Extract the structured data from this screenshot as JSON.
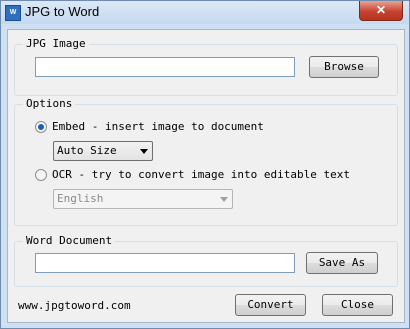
{
  "window": {
    "title": "JPG to Word",
    "icon_label": "W",
    "close_glyph": "✕"
  },
  "jpg_group": {
    "title": "JPG Image",
    "input_value": "",
    "browse_label": "Browse"
  },
  "options": {
    "title": "Options",
    "embed_label": "Embed - insert image to document",
    "embed_checked": true,
    "size_select_value": "Auto Size",
    "ocr_label": "OCR - try to convert image into editable text",
    "ocr_checked": false,
    "language_select_value": "English"
  },
  "word_group": {
    "title": "Word Document",
    "input_value": "",
    "save_as_label": "Save As"
  },
  "footer": {
    "website": "www.jpgtoword.com",
    "convert_label": "Convert",
    "close_label": "Close"
  }
}
